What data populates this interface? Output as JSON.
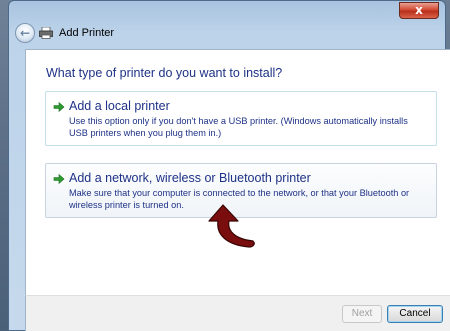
{
  "window": {
    "title": "Add Printer",
    "close_label": "x"
  },
  "main": {
    "question": "What type of printer do you want to install?",
    "options": [
      {
        "title": "Add a local printer",
        "description": "Use this option only if you don't have a USB printer. (Windows automatically installs USB printers when you plug them in.)",
        "icon": "green-arrow-icon"
      },
      {
        "title": "Add a network, wireless or Bluetooth printer",
        "description": "Make sure that your computer is connected to the network, or that your Bluetooth or wireless printer is turned on.",
        "icon": "green-arrow-icon"
      }
    ]
  },
  "footer": {
    "next_label": "Next",
    "cancel_label": "Cancel"
  },
  "colors": {
    "link_blue": "#1e3287",
    "arrow_green": "#2e9b32",
    "annotation_red": "#7a0d0d"
  }
}
